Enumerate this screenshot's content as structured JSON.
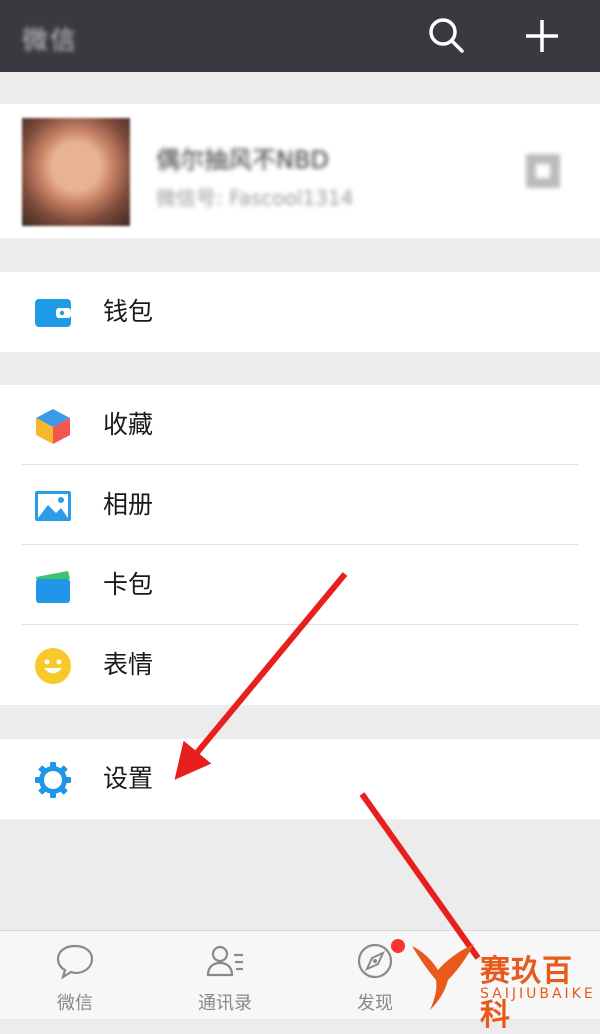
{
  "header": {
    "title": "微信",
    "search_icon": "search-icon",
    "add_icon": "plus-icon"
  },
  "profile": {
    "nickname": "偶尔抽风不NBD",
    "wechat_id": "微信号: Fascool1314"
  },
  "menu": {
    "wallet": "钱包",
    "favorites": "收藏",
    "album": "相册",
    "cards": "卡包",
    "stickers": "表情",
    "settings": "设置"
  },
  "tabs": [
    {
      "label": "微信",
      "icon": "chat-bubble-icon"
    },
    {
      "label": "通讯录",
      "icon": "contacts-icon"
    },
    {
      "label": "发现",
      "icon": "compass-icon"
    }
  ],
  "watermark": {
    "text": "赛玖百科",
    "subtext": "SAIJIUBAIKE"
  },
  "colors": {
    "header_bg": "#393a3f",
    "accent_blue": "#2196e8",
    "badge_red": "#f43530",
    "arrow_red": "#e8201d"
  }
}
